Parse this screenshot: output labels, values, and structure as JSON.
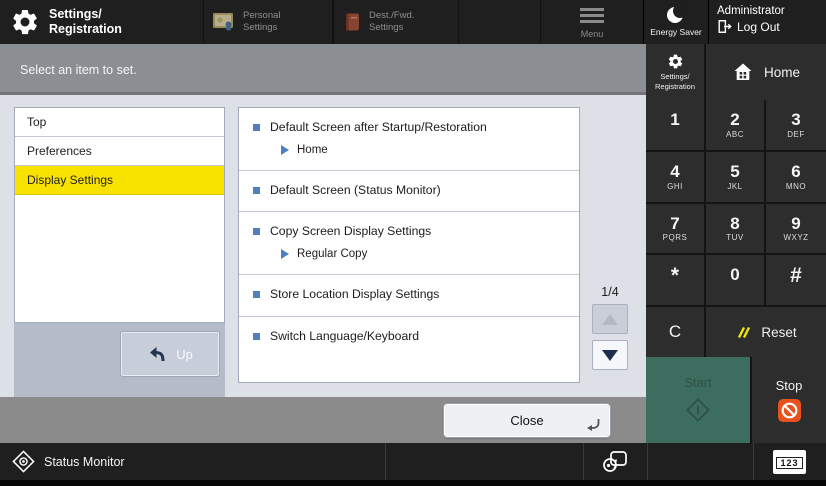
{
  "app": {
    "title_line1": "Settings/",
    "title_line2": "Registration"
  },
  "top_bar": {
    "personal_settings": "Personal Settings",
    "dest_fwd_settings": "Dest./Fwd. Settings",
    "menu": "Menu",
    "energy_saver": "Energy Saver",
    "user_name": "Administrator",
    "log_out": "Log Out"
  },
  "message_bar": {
    "text": "Select an item to set."
  },
  "side_nav": {
    "settings_line1": "Settings/",
    "settings_line2": "Registration",
    "home": "Home"
  },
  "left_panel": {
    "items": [
      {
        "label": "Top",
        "selected": false
      },
      {
        "label": "Preferences",
        "selected": false
      },
      {
        "label": "Display Settings",
        "selected": true
      }
    ],
    "up_label": "Up"
  },
  "settings_list": {
    "items": [
      {
        "label": "Default Screen after Startup/Restoration",
        "value": "Home"
      },
      {
        "label": "Default Screen (Status Monitor)",
        "value": ""
      },
      {
        "label": "Copy Screen Display Settings",
        "value": "Regular Copy"
      },
      {
        "label": "Store Location Display Settings",
        "value": ""
      },
      {
        "label": "Switch Language/Keyboard",
        "value": ""
      }
    ]
  },
  "pagination": {
    "page": "1/4"
  },
  "keypad": {
    "keys": [
      {
        "digit": "1",
        "letters": ""
      },
      {
        "digit": "2",
        "letters": "ABC"
      },
      {
        "digit": "3",
        "letters": "DEF"
      },
      {
        "digit": "4",
        "letters": "GHI"
      },
      {
        "digit": "5",
        "letters": "JKL"
      },
      {
        "digit": "6",
        "letters": "MNO"
      },
      {
        "digit": "7",
        "letters": "PQRS"
      },
      {
        "digit": "8",
        "letters": "TUV"
      },
      {
        "digit": "9",
        "letters": "WXYZ"
      },
      {
        "digit": "*",
        "letters": ""
      },
      {
        "digit": "0",
        "letters": ""
      },
      {
        "digit": "#",
        "letters": ""
      }
    ],
    "clear": "C",
    "reset": "Reset"
  },
  "hard_keys": {
    "start": "Start",
    "stop": "Stop"
  },
  "dialog": {
    "close": "Close"
  },
  "status_bar": {
    "status_monitor": "Status Monitor",
    "numeric_badge": "123"
  },
  "colors": {
    "accent_yellow": "#f8e300",
    "bullet_blue": "#4e80c0",
    "start_teal": "#3d6d5f",
    "stop_orange": "#e8531d"
  }
}
